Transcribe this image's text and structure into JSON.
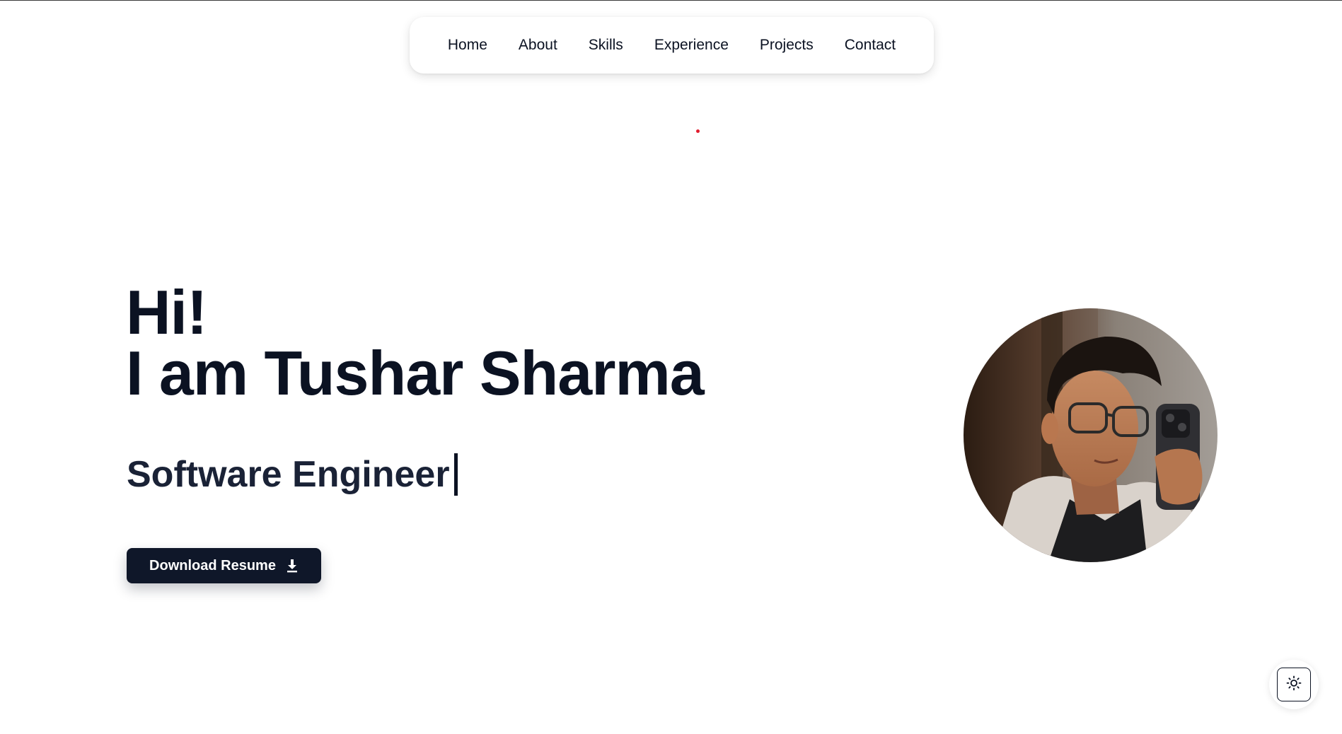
{
  "nav": {
    "items": [
      {
        "label": "Home"
      },
      {
        "label": "About"
      },
      {
        "label": "Skills"
      },
      {
        "label": "Experience"
      },
      {
        "label": "Projects"
      },
      {
        "label": "Contact"
      }
    ]
  },
  "hero": {
    "greeting": "Hi!",
    "intro": "I am Tushar Sharma",
    "role": "Software Engineer",
    "download_label": "Download Resume",
    "download_icon": "download-icon"
  },
  "profile": {
    "photo": "profile-photo"
  },
  "theme_toggle": {
    "icon": "sun-icon"
  },
  "colors": {
    "text_primary": "#0b1222",
    "button_bg": "#0f1729",
    "button_text": "#ffffff",
    "accent_dot": "#e11d2e",
    "background": "#ffffff"
  }
}
